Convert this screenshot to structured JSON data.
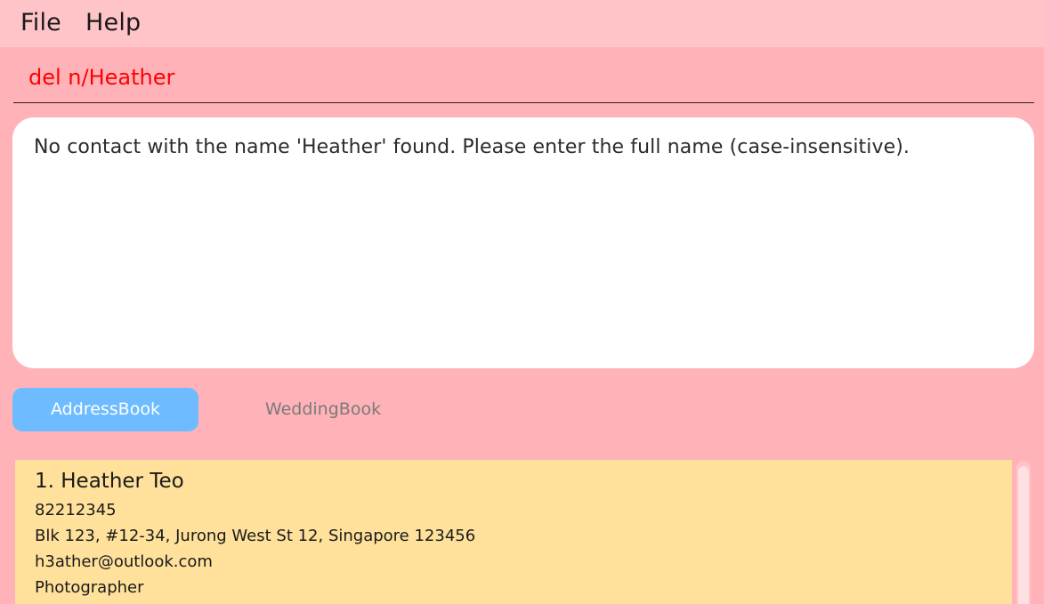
{
  "menubar": {
    "file": "File",
    "help": "Help"
  },
  "command": {
    "value": "del n/Heather"
  },
  "result": {
    "message": "No contact with the name 'Heather' found. Please enter the full name (case-insensitive)."
  },
  "tabs": {
    "addressbook": "AddressBook",
    "weddingbook": "WeddingBook",
    "active": "AddressBook"
  },
  "persons": [
    {
      "title": "1. Heather Teo",
      "phone": "82212345",
      "address": "Blk 123, #12-34, Jurong West St 12, Singapore 123456",
      "email": "h3ather@outlook.com",
      "job": "Photographer"
    }
  ],
  "colors": {
    "background": "#ffb3b8",
    "menubar": "#ffc4c8",
    "command_text": "#ff0000",
    "active_tab": "#6ebcff",
    "card": "#ffe19b"
  }
}
